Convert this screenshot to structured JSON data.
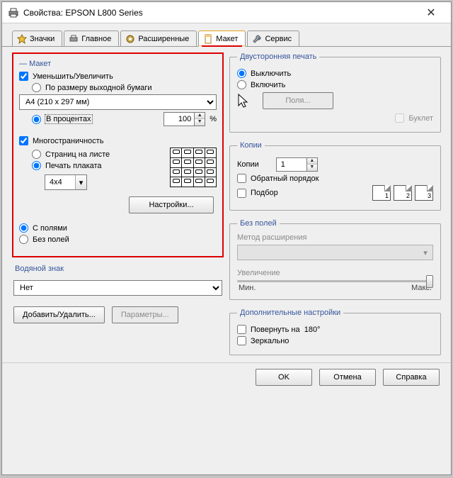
{
  "window": {
    "title": "Свойства: EPSON L800 Series"
  },
  "tabs": {
    "icons": "Значки",
    "main": "Главное",
    "advanced": "Расширенные",
    "layout": "Макет",
    "service": "Сервис"
  },
  "layout": {
    "legend": "Макет",
    "reduce_enlarge": "Уменьшить/Увеличить",
    "fit_to_output": "По размеру выходной бумаги",
    "paper_size": "A4 (210 x 297 мм)",
    "by_percent": "В процентах",
    "percent_value": "100",
    "percent_sign": "%",
    "multipage": "Многостраничность",
    "pages_per_sheet": "Страниц на листе",
    "poster_print": "Печать плаката",
    "poster_size": "4x4",
    "settings_btn": "Настройки...",
    "with_margins": "С полями",
    "borderless": "Без полей"
  },
  "watermark": {
    "legend": "Водяной знак",
    "value": "Нет",
    "add_remove": "Добавить/Удалить...",
    "params": "Параметры..."
  },
  "duplex": {
    "legend": "Двусторонняя печать",
    "off": "Выключить",
    "on": "Включить",
    "margins_btn": "Поля...",
    "booklet": "Буклет"
  },
  "copies": {
    "legend": "Копии",
    "label": "Копии",
    "value": "1",
    "reverse": "Обратный порядок",
    "collate": "Подбор",
    "sheet1": "1",
    "sheet2": "2",
    "sheet3": "3"
  },
  "borderless_right": {
    "legend": "Без полей",
    "method": "Метод расширения",
    "enlarge": "Увеличение",
    "min": "Мин.",
    "max": "Макс."
  },
  "extra": {
    "legend": "Дополнительные настройки",
    "rotate": "Повернуть на",
    "rotate_deg": "180°",
    "mirror": "Зеркально"
  },
  "footer": {
    "ok": "OK",
    "cancel": "Отмена",
    "help": "Справка"
  }
}
